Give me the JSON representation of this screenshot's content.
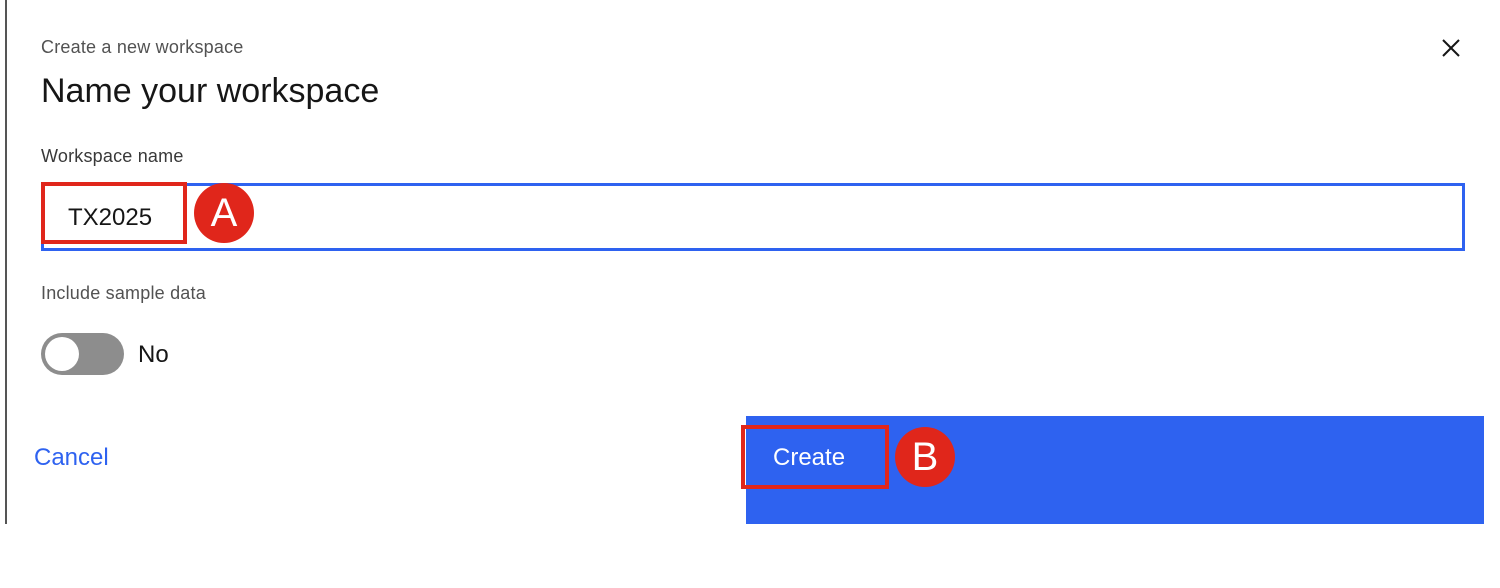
{
  "dialog": {
    "overline": "Create a new workspace",
    "heading": "Name your workspace",
    "close_icon": "close-icon"
  },
  "workspace_name": {
    "label": "Workspace name",
    "value": "TX2025"
  },
  "sample_data": {
    "label": "Include sample data",
    "state_label": "No",
    "enabled": false
  },
  "actions": {
    "cancel_label": "Cancel",
    "create_label": "Create"
  },
  "annotations": {
    "marker_a": "A",
    "marker_b": "B"
  },
  "colors": {
    "accent": "#2e62f0",
    "annotation": "#e0261b",
    "toggle_off": "#8d8d8d"
  }
}
